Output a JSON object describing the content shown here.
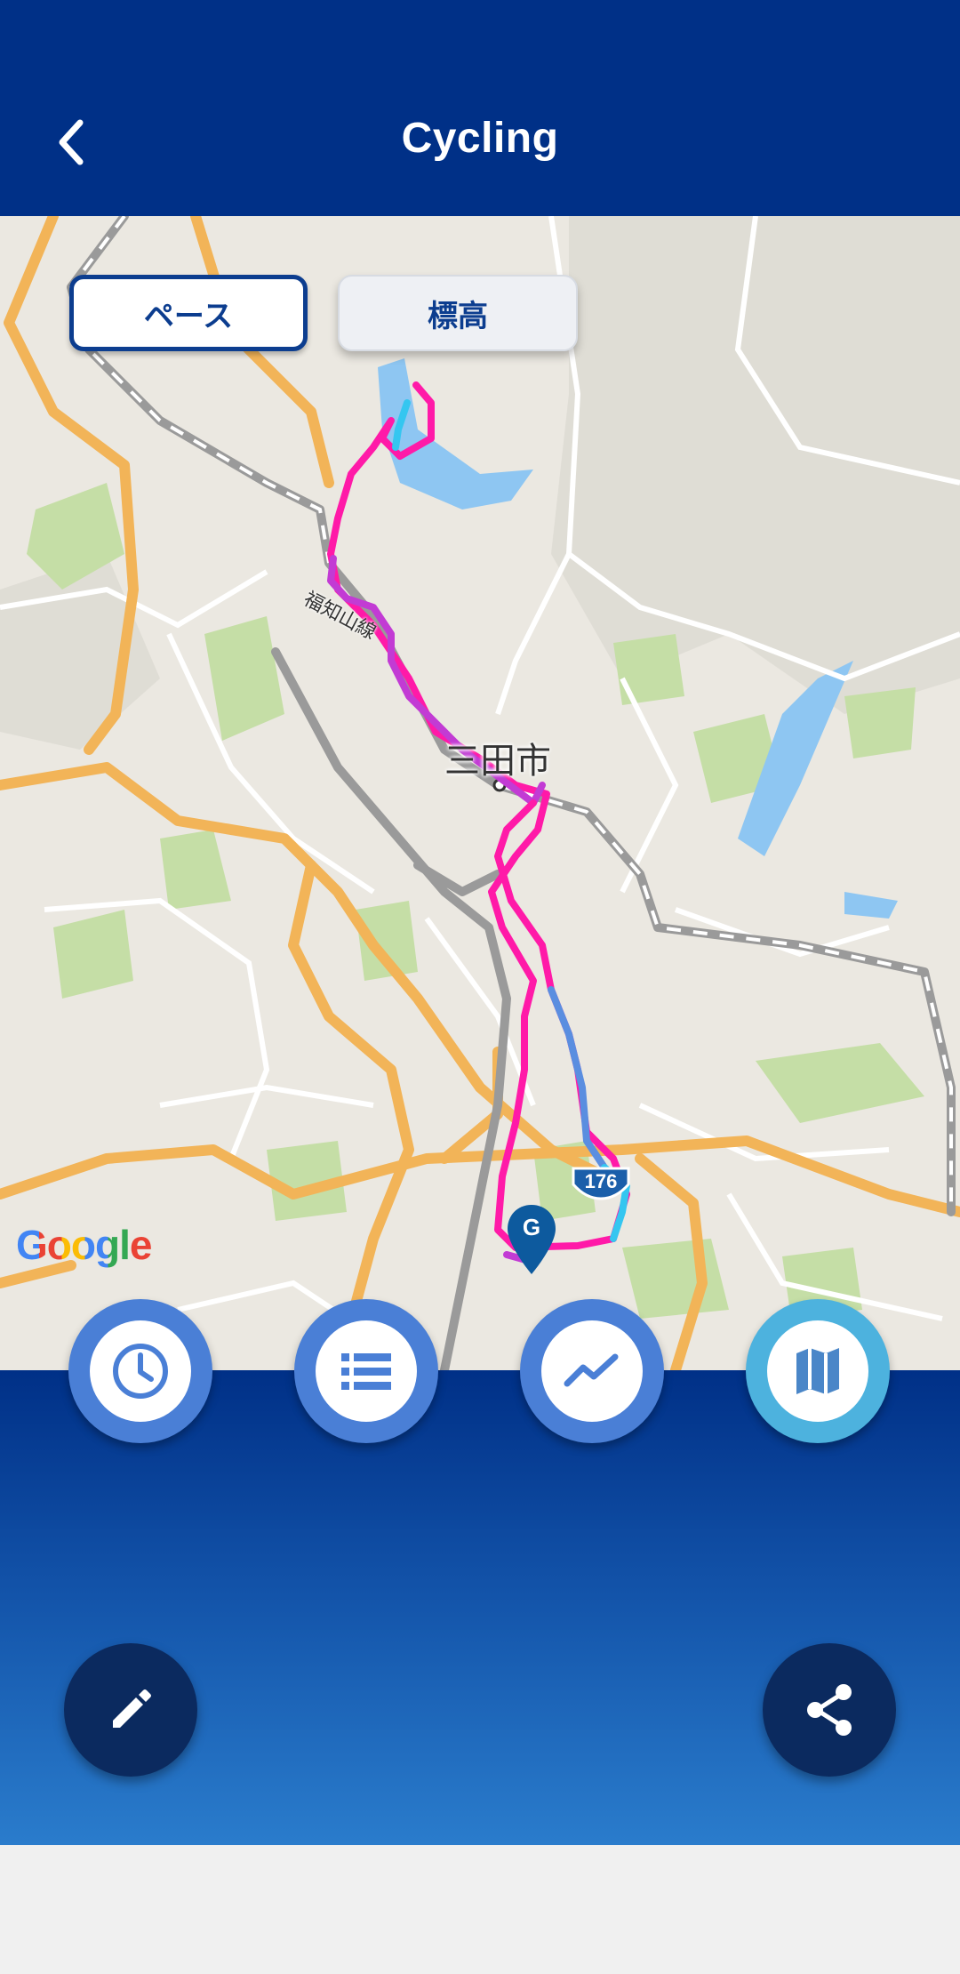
{
  "header": {
    "title": "Cycling",
    "back_icon": "chevron-left-icon",
    "background": "#003087"
  },
  "map": {
    "toggle": {
      "pace_label": "ペース",
      "altitude_label": "標高",
      "selected": "ペース"
    },
    "city_label": "三田市",
    "rail_label": "福知山線",
    "route_shield": "176",
    "goal_marker": "G",
    "attribution": "Google",
    "route_colors": [
      "#ff1aa8",
      "#c23bd4",
      "#5a8ee0",
      "#34c6f0"
    ]
  },
  "tabs": [
    {
      "name": "time",
      "icon": "clock-icon",
      "active": false
    },
    {
      "name": "list",
      "icon": "list-icon",
      "active": false
    },
    {
      "name": "graph",
      "icon": "trend-icon",
      "active": false
    },
    {
      "name": "map",
      "icon": "map-icon",
      "active": true
    }
  ],
  "actions": [
    {
      "name": "edit",
      "icon": "pencil-icon"
    },
    {
      "name": "share",
      "icon": "share-icon"
    }
  ],
  "colors": {
    "accent": "#4a7fd6",
    "active_tab": "#4db2de",
    "fab": "#0b2a5f",
    "button_text": "#0c3d8f"
  }
}
